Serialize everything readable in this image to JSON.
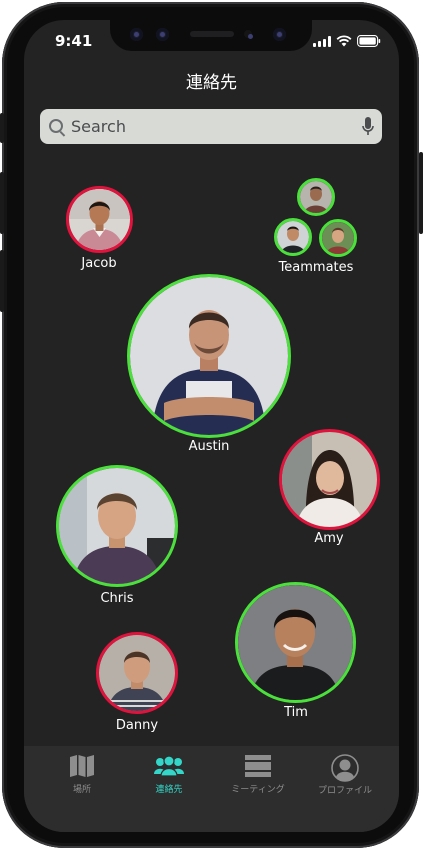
{
  "status_bar": {
    "time": "9:41",
    "icons": [
      "signal-icon",
      "wifi-icon",
      "battery-icon"
    ]
  },
  "nav": {
    "title": "連絡先"
  },
  "search": {
    "placeholder": "Search"
  },
  "contacts": [
    {
      "name": "Jacob",
      "status": "red"
    },
    {
      "name": "Teammates",
      "status": "green",
      "members": 3
    },
    {
      "name": "Austin",
      "status": "green"
    },
    {
      "name": "Amy",
      "status": "red"
    },
    {
      "name": "Chris",
      "status": "green"
    },
    {
      "name": "Danny",
      "status": "red"
    },
    {
      "name": "Tim",
      "status": "green"
    }
  ],
  "tabs": [
    {
      "label": "場所",
      "icon": "map-icon",
      "active": false
    },
    {
      "label": "連絡先",
      "icon": "contacts-icon",
      "active": true
    },
    {
      "label": "ミーティング",
      "icon": "meeting-icon",
      "active": false
    },
    {
      "label": "プロファイル",
      "icon": "profile-icon",
      "active": false
    }
  ],
  "colors": {
    "offline": "#e2123d",
    "online": "#49e13a",
    "accent": "#33d6c8",
    "background": "#232323"
  }
}
